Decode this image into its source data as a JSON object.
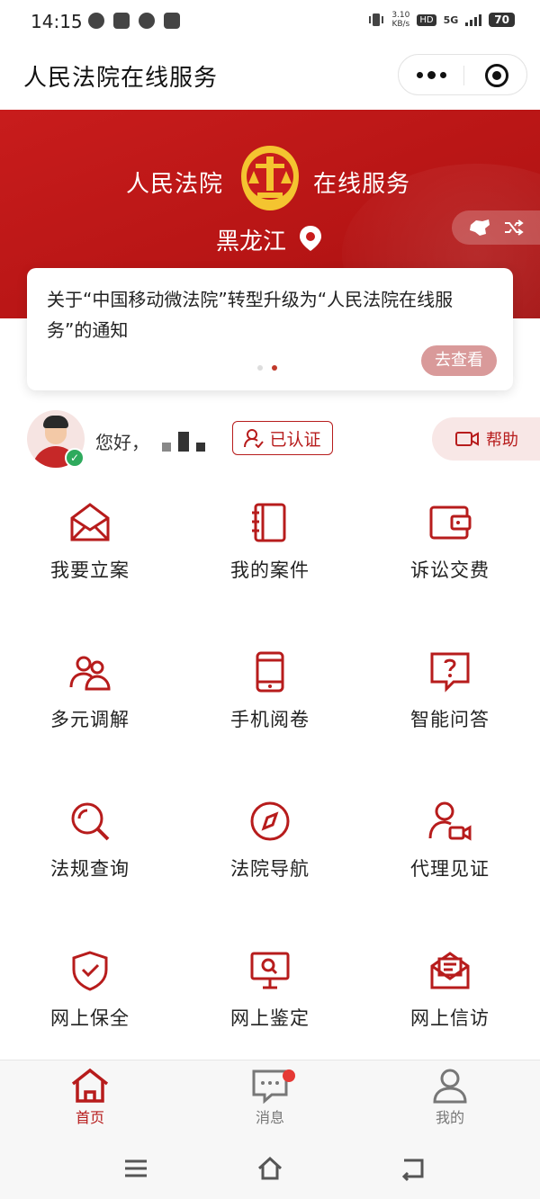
{
  "status_bar": {
    "time": "14:15",
    "speed_value": "3.10",
    "speed_unit": "KB/s",
    "hd": "HD",
    "network": "5G",
    "battery": "70"
  },
  "header": {
    "title": "人民法院在线服务"
  },
  "banner": {
    "title_left": "人民法院",
    "title_right": "在线服务",
    "region": "黑龙江"
  },
  "notice": {
    "text": "关于“中国移动微法院”转型升级为“人民法院在线服务”的通知",
    "view_label": "去查看"
  },
  "user": {
    "greeting": "您好，",
    "cert_label": "已认证",
    "help_label": "帮助"
  },
  "services": [
    {
      "label": "我要立案",
      "icon": "envelope-icon"
    },
    {
      "label": "我的案件",
      "icon": "case-file-icon"
    },
    {
      "label": "诉讼交费",
      "icon": "wallet-icon"
    },
    {
      "label": "多元调解",
      "icon": "people-icon"
    },
    {
      "label": "手机阅卷",
      "icon": "phone-icon"
    },
    {
      "label": "智能问答",
      "icon": "question-icon"
    },
    {
      "label": "法规查询",
      "icon": "search-icon"
    },
    {
      "label": "法院导航",
      "icon": "compass-icon"
    },
    {
      "label": "代理见证",
      "icon": "user-video-icon"
    },
    {
      "label": "网上保全",
      "icon": "shield-check-icon"
    },
    {
      "label": "网上鉴定",
      "icon": "monitor-search-icon"
    },
    {
      "label": "网上信访",
      "icon": "mail-open-icon"
    }
  ],
  "tabs": [
    {
      "label": "首页",
      "active": true
    },
    {
      "label": "消息",
      "active": false
    },
    {
      "label": "我的",
      "active": false
    }
  ],
  "colors": {
    "brand_red": "#b71c1c",
    "banner_red": "#c81c1c"
  }
}
